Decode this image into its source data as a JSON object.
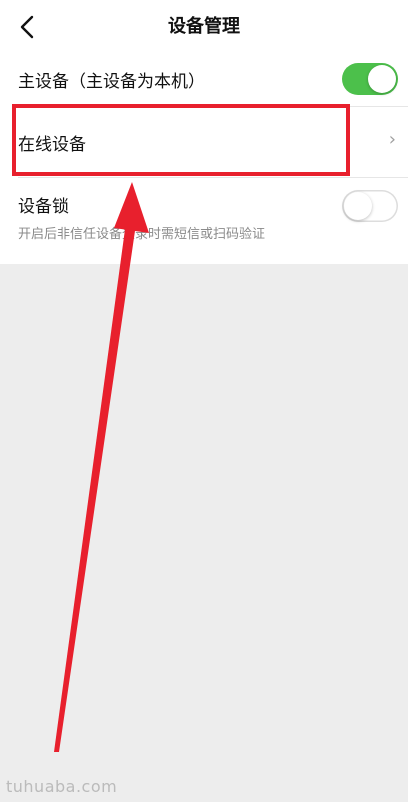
{
  "header": {
    "title": "设备管理"
  },
  "settings": {
    "primary_device": {
      "label": "主设备（主设备为本机）",
      "toggle_on": true
    },
    "online_devices": {
      "label": "在线设备",
      "chevron": "›"
    },
    "device_lock": {
      "label": "设备锁",
      "description": "开启后非信任设备登录时需短信或扫码验证",
      "toggle_on": false
    }
  },
  "colors": {
    "toggle_on": "#4cc04b",
    "annotation_red": "#e8202d",
    "background": "#ededed"
  },
  "watermark": "tuhuaba.com"
}
